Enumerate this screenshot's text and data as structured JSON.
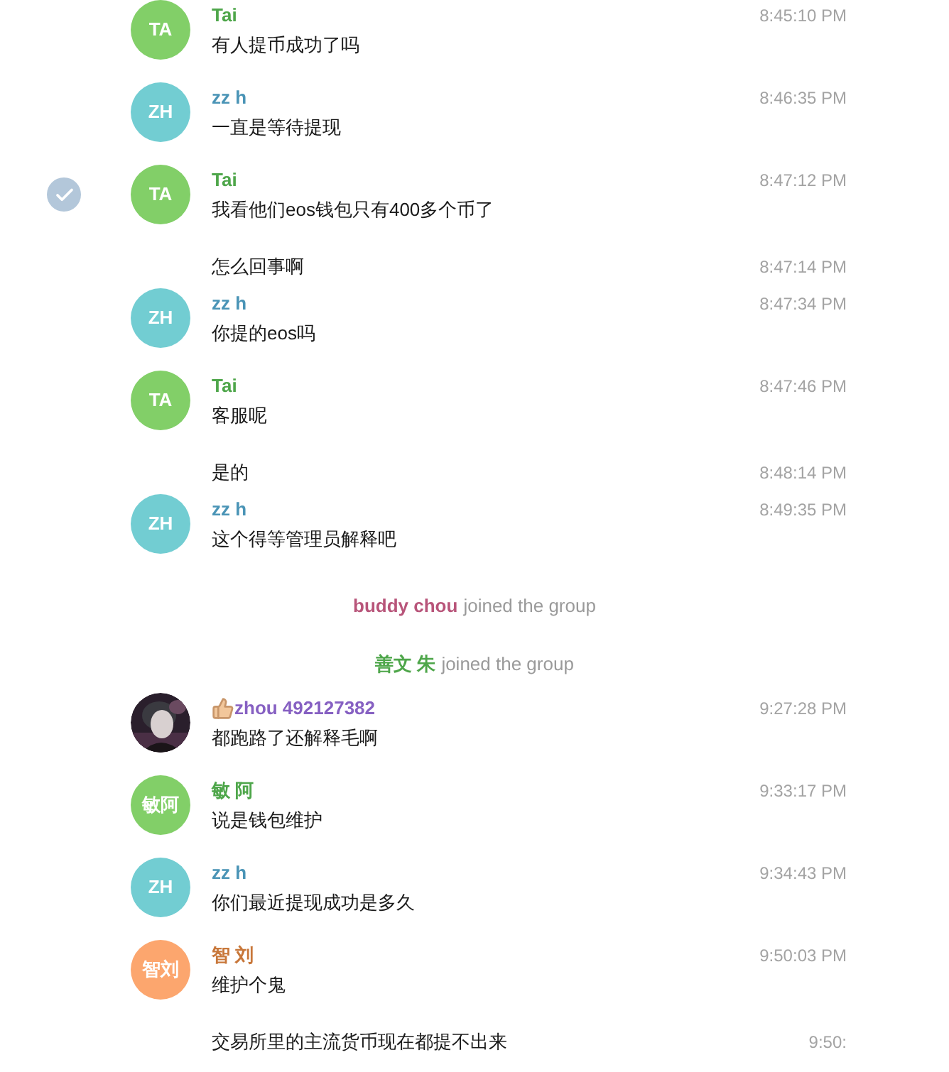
{
  "messages": [
    {
      "kind": "message",
      "selected": false,
      "avatar": {
        "kind": "initials",
        "text": "TA",
        "color": "#82cf68"
      },
      "name": "Tai",
      "color": "#4ea64a",
      "text": "有人提币成功了吗",
      "time": "8:45:10 PM"
    },
    {
      "kind": "message",
      "selected": false,
      "avatar": {
        "kind": "initials",
        "text": "ZH",
        "color": "#72cdd2"
      },
      "name": "zz h",
      "color": "#4a94b6",
      "text": "一直是等待提现",
      "time": "8:46:35 PM"
    },
    {
      "kind": "message",
      "selected": true,
      "avatar": {
        "kind": "initials",
        "text": "TA",
        "color": "#82cf68"
      },
      "name": "Tai",
      "color": "#4ea64a",
      "text": "我看他们eos钱包只有400多个币了",
      "time": "8:47:12 PM"
    },
    {
      "kind": "continuation",
      "selected": false,
      "text": "怎么回事啊",
      "time": "8:47:14 PM"
    },
    {
      "kind": "message",
      "selected": false,
      "avatar": {
        "kind": "initials",
        "text": "ZH",
        "color": "#72cdd2"
      },
      "name": "zz h",
      "color": "#4a94b6",
      "text": "你提的eos吗",
      "time": "8:47:34 PM"
    },
    {
      "kind": "message",
      "selected": false,
      "avatar": {
        "kind": "initials",
        "text": "TA",
        "color": "#82cf68"
      },
      "name": "Tai",
      "color": "#4ea64a",
      "text": "客服呢",
      "time": "8:47:46 PM"
    },
    {
      "kind": "continuation",
      "selected": false,
      "text": "是的",
      "time": "8:48:14 PM"
    },
    {
      "kind": "message",
      "selected": false,
      "avatar": {
        "kind": "initials",
        "text": "ZH",
        "color": "#72cdd2"
      },
      "name": "zz h",
      "color": "#4a94b6",
      "text": "这个得等管理员解释吧",
      "time": "8:49:35 PM"
    },
    {
      "kind": "service",
      "name": "buddy chou",
      "color": "#b8557a",
      "text": "joined the group"
    },
    {
      "kind": "service",
      "name": "善文 朱",
      "color": "#4ea64a",
      "text": "joined the group"
    },
    {
      "kind": "message",
      "selected": false,
      "name_icon": {
        "kind": "thumbs_up"
      },
      "name": "zhou 492127382",
      "color": "#8660c2",
      "text": "都跑路了还解释毛啊",
      "time": "9:27:28 PM"
    },
    {
      "kind": "message",
      "selected": false,
      "avatar": {
        "kind": "initials",
        "text": "敏阿",
        "color": "#82cf68"
      },
      "name": "敏 阿",
      "color": "#4ea64a",
      "text": "说是钱包维护",
      "time": "9:33:17 PM"
    },
    {
      "kind": "message",
      "selected": false,
      "avatar": {
        "kind": "initials",
        "text": "ZH",
        "color": "#72cdd2"
      },
      "name": "zz h",
      "color": "#4a94b6",
      "text": "你们最近提现成功是多久",
      "time": "9:34:43 PM"
    },
    {
      "kind": "message",
      "selected": false,
      "avatar": {
        "kind": "initials",
        "text": "智刘",
        "color": "#fca66e"
      },
      "name": "智 刘",
      "color": "#c8773a",
      "text": "维护个鬼",
      "time": "9:50:03 PM"
    },
    {
      "kind": "continuation",
      "selected": false,
      "text": "交易所里的主流货币现在都提不出来",
      "time": "9:50:"
    }
  ]
}
